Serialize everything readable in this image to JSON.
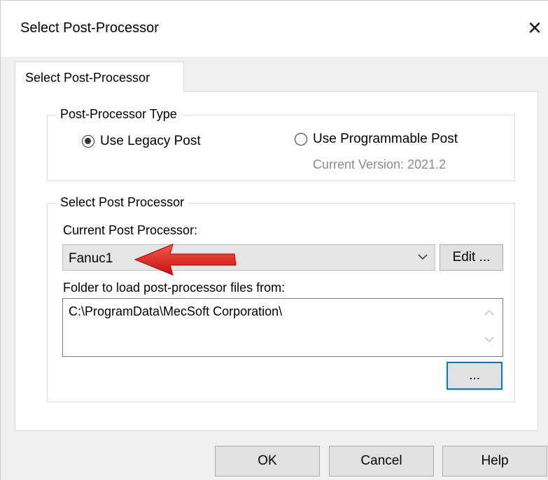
{
  "window": {
    "title": "Select Post-Processor",
    "close_glyph": "✕"
  },
  "tabs": [
    {
      "label": "Select Post-Processor"
    }
  ],
  "post_type": {
    "legend": "Post-Processor Type",
    "options": [
      {
        "label": "Use Legacy Post",
        "checked": true
      },
      {
        "label": "Use Programmable Post",
        "checked": false
      }
    ],
    "version_text": "Current Version: 2021.2"
  },
  "select_post": {
    "legend": "Select Post Processor",
    "current_label": "Current Post Processor:",
    "current_value": "Fanuc1",
    "edit_button": "Edit ...",
    "folder_label": "Folder to load post-processor files from:",
    "folder_value": "C:\\ProgramData\\MecSoft Corporation\\",
    "browse_button": "..."
  },
  "footer": {
    "ok": "OK",
    "cancel": "Cancel",
    "help": "Help"
  },
  "colors": {
    "accent": "#0078d7",
    "arrow": "#e21a1a"
  },
  "icons": {
    "close": "close-icon",
    "dropdown": "chevron-down-icon",
    "scroll_up": "chevron-up-icon",
    "scroll_down": "chevron-down-icon",
    "annotation": "arrow-icon"
  }
}
